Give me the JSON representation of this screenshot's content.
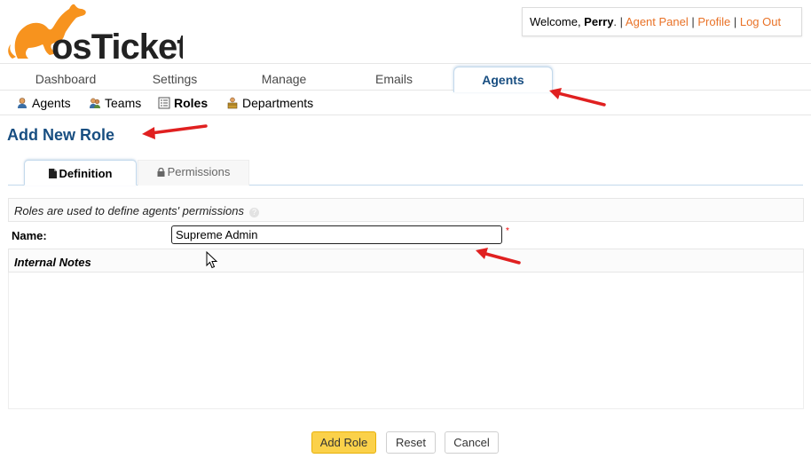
{
  "logo": {
    "text_os": "os",
    "text_ticket": "Ticket",
    "brand_color": "#f7931e"
  },
  "header": {
    "welcome_prefix": "Welcome, ",
    "user_name": "Perry",
    "after_name": ". | ",
    "agent_panel": "Agent Panel",
    "sep": " | ",
    "profile": "Profile",
    "logout": "Log Out"
  },
  "nav": {
    "tabs": [
      {
        "label": "Dashboard"
      },
      {
        "label": "Settings"
      },
      {
        "label": "Manage"
      },
      {
        "label": "Emails"
      },
      {
        "label": "Agents",
        "active": true
      }
    ]
  },
  "subnav": {
    "items": [
      {
        "label": "Agents",
        "icon": "agent-icon"
      },
      {
        "label": "Teams",
        "icon": "team-icon"
      },
      {
        "label": "Roles",
        "icon": "roles-icon",
        "active": true
      },
      {
        "label": "Departments",
        "icon": "department-icon"
      }
    ]
  },
  "page": {
    "title": "Add New Role"
  },
  "form_tabs": [
    {
      "label": "Definition",
      "icon": "document-icon",
      "active": true
    },
    {
      "label": "Permissions",
      "icon": "lock-icon"
    }
  ],
  "form": {
    "info_text": "Roles are used to define agents' permissions",
    "help_icon": "?",
    "name_label": "Name:",
    "name_value": "Supreme Admin",
    "required_mark": "*",
    "notes_label": "Internal Notes"
  },
  "buttons": {
    "add": "Add Role",
    "reset": "Reset",
    "cancel": "Cancel"
  },
  "colors": {
    "link": "#e97227",
    "title": "#184e81",
    "primary_button": "#fbd14a",
    "annotation_arrow": "#e02020"
  }
}
